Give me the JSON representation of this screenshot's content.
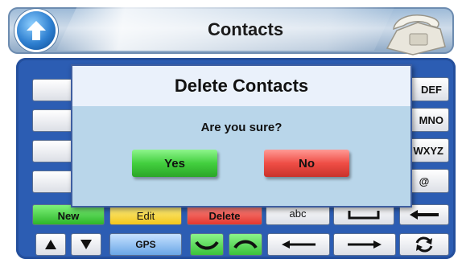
{
  "header": {
    "title": "Contacts",
    "back_icon": "up-arrow-icon",
    "app_icon": "telephone-icon"
  },
  "keypad": {
    "right_keys": [
      "DEF",
      "MNO",
      "WXYZ",
      "@"
    ],
    "row_actions": {
      "new": "New",
      "edit": "Edit",
      "delete": "Delete",
      "abc": "abc"
    },
    "bottom": {
      "gps": "GPS"
    }
  },
  "dialog": {
    "title": "Delete Contacts",
    "message": "Are you sure?",
    "yes_label": "Yes",
    "no_label": "No"
  },
  "colors": {
    "panel": "#2c5db3",
    "yes": "#43cf3f",
    "no": "#ef4e46",
    "dialog": "#b9d6ea"
  }
}
